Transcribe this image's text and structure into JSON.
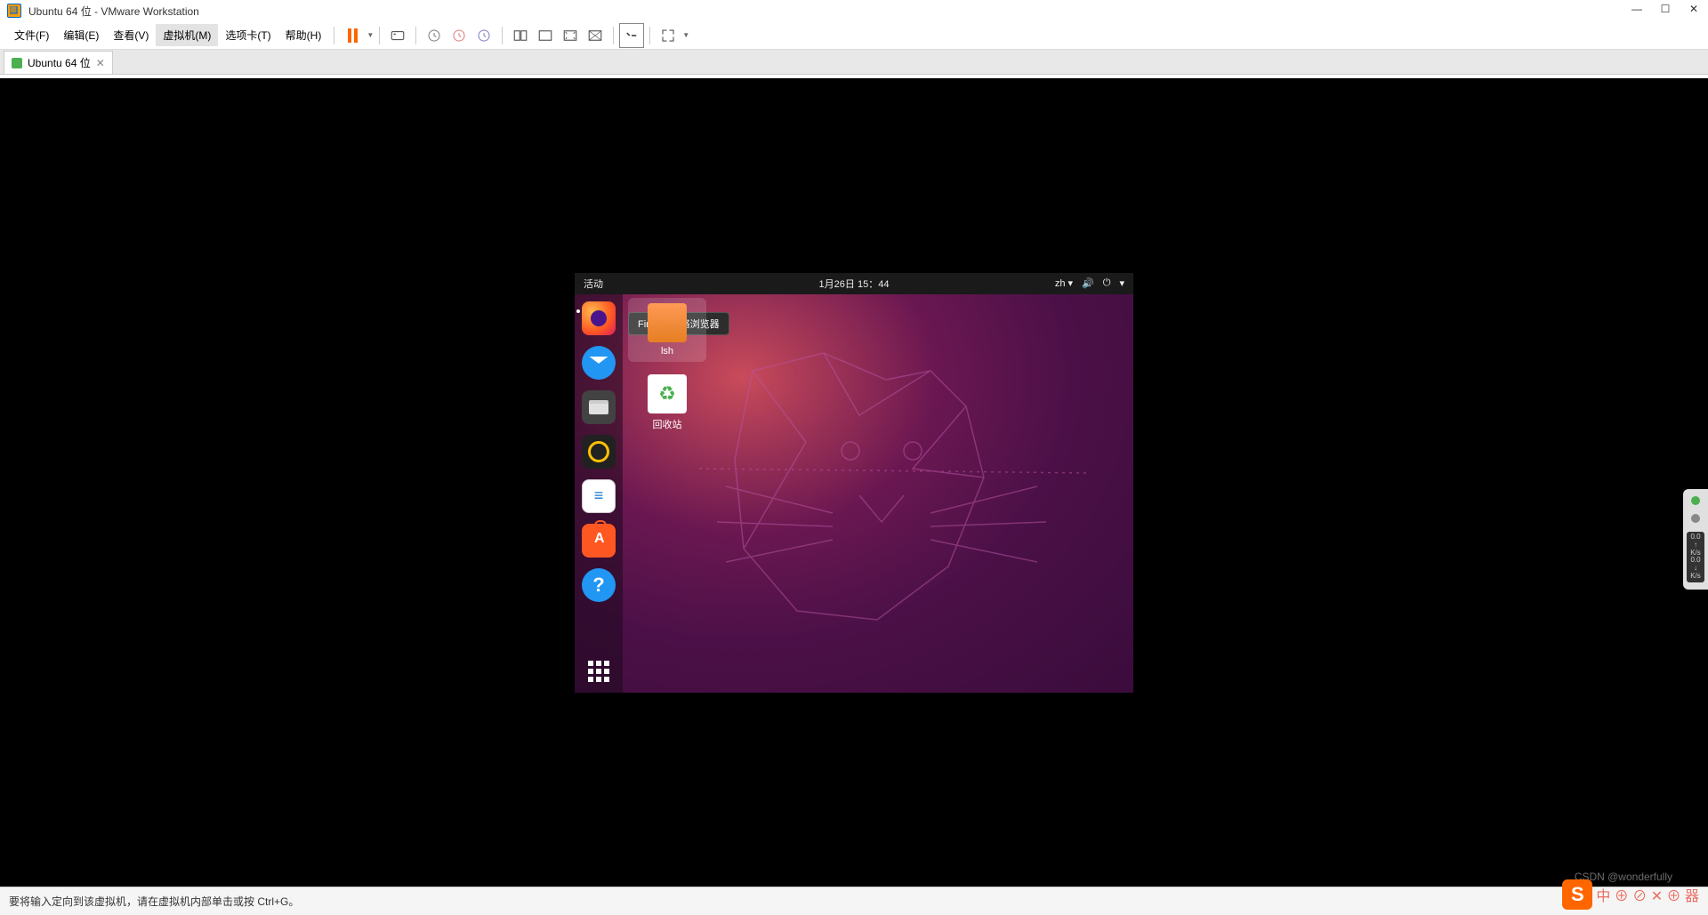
{
  "window": {
    "title": "Ubuntu 64 位 - VMware Workstation"
  },
  "menubar": {
    "file": "文件(F)",
    "edit": "编辑(E)",
    "view": "查看(V)",
    "vm": "虚拟机(M)",
    "tabs": "选项卡(T)",
    "help": "帮助(H)"
  },
  "tabs": {
    "active": "Ubuntu 64 位"
  },
  "ubuntu": {
    "activities": "活动",
    "datetime": "1月26日 15：44",
    "ime": "zh",
    "tooltip": "Firefox 网络浏览器",
    "desktop": {
      "folder1": "lsh",
      "trash": "回收站"
    }
  },
  "statusbar": {
    "hint": "要将输入定向到该虚拟机，请在虚拟机内部单击或按 Ctrl+G。"
  },
  "side": {
    "rate1": "0.0",
    "unit1": "K/s",
    "rate2": "0.0",
    "unit2": "K/s"
  },
  "overlay": {
    "s": "S",
    "text": "中 ⊕ ⊘ ✕ ⊕ 器",
    "watermark": "CSDN @wonderfully"
  }
}
